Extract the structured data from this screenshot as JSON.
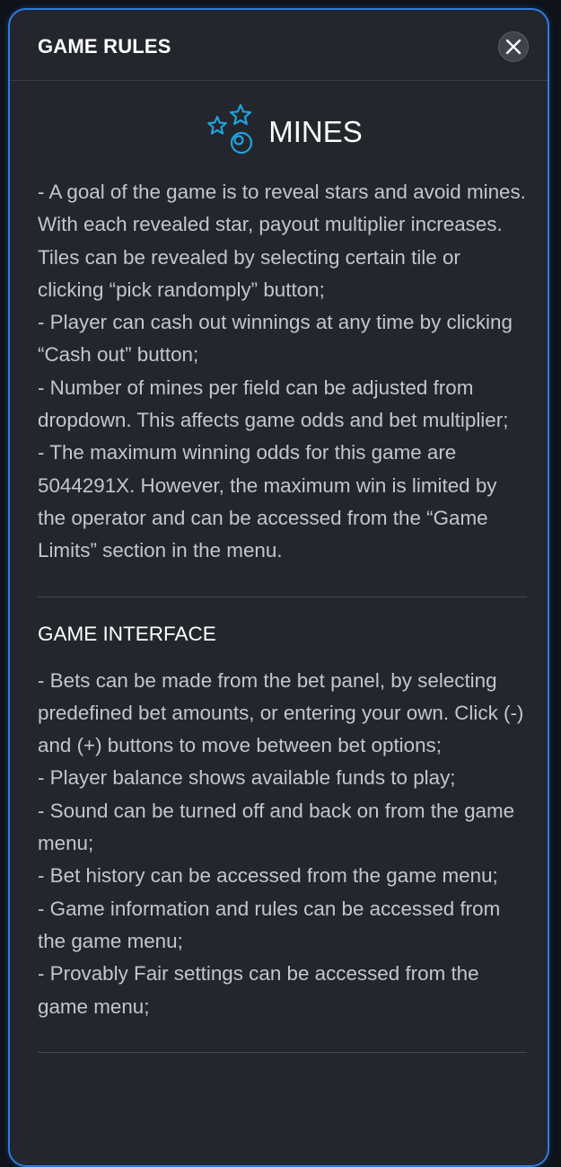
{
  "header": {
    "title": "GAME RULES",
    "close_icon": "close-icon"
  },
  "game": {
    "name": "MINES",
    "logo_icon": "stars-and-mine-icon",
    "accent_color": "#1fa3e0"
  },
  "rules": [
    "- A goal of the game is to reveal stars and avoid mines. With each revealed star, payout multiplier increases. Tiles can be revealed by selecting certain tile or clicking “pick randomply” button;",
    "- Player can cash out winnings at any time by clicking “Cash out” button;",
    "- Number of mines per field can be adjusted from dropdown. This affects game odds and bet multiplier;",
    "- The maximum winning odds for this game are 5044291X. However, the maximum win is limited by the operator and can be accessed from the “Game Limits” section in the menu."
  ],
  "interface": {
    "title": "GAME INTERFACE",
    "items": [
      "- Bets can be made from the bet panel, by selecting predefined bet amounts, or entering your own. Click (-) and (+) buttons to move between bet options;",
      "- Player balance shows available funds to play;",
      "- Sound can be turned off and back on from the game menu;",
      "- Bet history can be accessed from the game menu;",
      "- Game information and rules can be accessed from the game menu;",
      "- Provably Fair settings can be accessed from the game menu;"
    ]
  }
}
